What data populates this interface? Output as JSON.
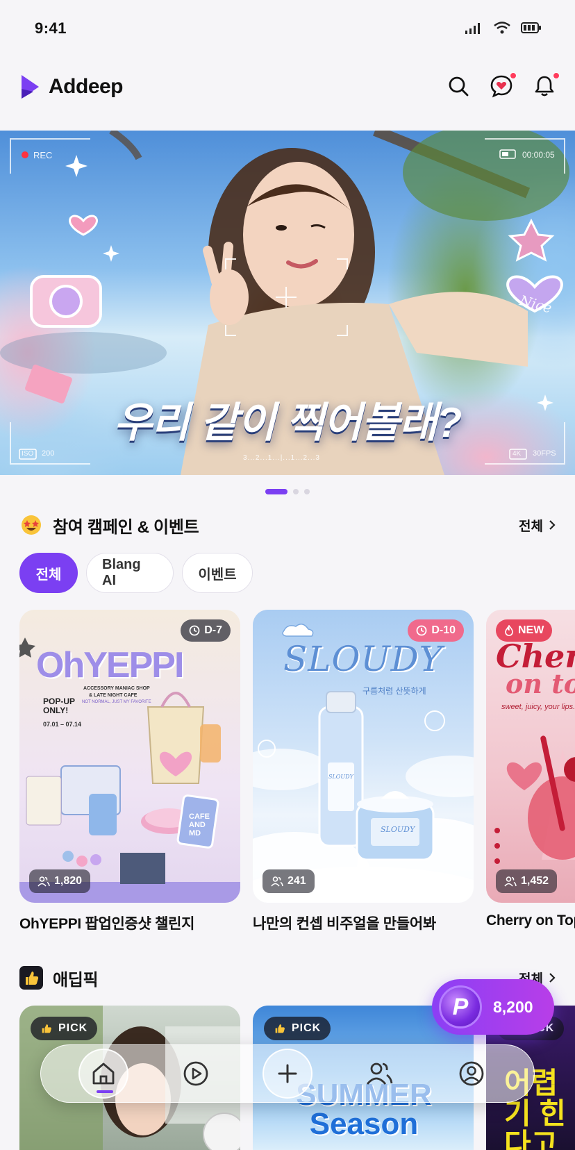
{
  "status_bar": {
    "time": "9:41"
  },
  "header": {
    "app_name": "Addeep",
    "icons": [
      "search-icon",
      "heart-chat-icon",
      "bell-icon"
    ]
  },
  "hero": {
    "rec_label": "REC",
    "timer": "00:00:05",
    "iso_label": "ISO",
    "iso_value": "200",
    "format_label": "4K",
    "fps": "30FPS",
    "exposure_scale": "3...2...1...|...1...2...3",
    "headline": "우리 같이 찍어볼래?",
    "sticker_text": "Nice",
    "slides_total": 3,
    "active_slide": 1
  },
  "campaign_section": {
    "title": "참여 캠페인 & 이벤트",
    "see_all": "전체",
    "filters": [
      {
        "label": "전체",
        "active": true
      },
      {
        "label": "Blang AI",
        "active": false
      },
      {
        "label": "이벤트",
        "active": false
      }
    ],
    "cards": [
      {
        "title": "OhYEPPI 팝업인증샷 챌린지",
        "badge": "D-7",
        "participants": "1,820",
        "poster": {
          "logo": "OhYEPPI",
          "line1": "ACCESSORY MANIAC SHOP",
          "line2": "& LATE NIGHT CAFE",
          "line3": "NOT NORMAL, JUST MY FAVORITE",
          "popup": "POP-UP ONLY!",
          "dates": "07.01 – 07.14",
          "cafe": "CAFE AND MD"
        }
      },
      {
        "title": "나만의 컨셉 비주얼을 만들어봐",
        "badge": "D-10",
        "participants": "241",
        "poster": {
          "logo": "SLOUDY",
          "tagline": "구름처럼 산뜻하게",
          "bottle_label": "SLOUDY",
          "jar_label": "SLOUDY"
        }
      },
      {
        "title": "Cherry on Top",
        "badge": "NEW",
        "participants": "1,452",
        "poster": {
          "line1": "Cherry",
          "line2": "on top",
          "tagline": "sweet, juicy, your lips."
        }
      }
    ]
  },
  "pick_section": {
    "title": "애딥픽",
    "see_all": "전체",
    "cards": [
      {
        "badge": "PICK",
        "text": ""
      },
      {
        "badge": "PICK",
        "text": "SUMMER Season"
      },
      {
        "badge": "PICK",
        "text": "어렵기 힌다고"
      }
    ]
  },
  "points": {
    "symbol": "P",
    "value": "8,200"
  },
  "bottom_nav": {
    "items": [
      {
        "icon": "home-icon",
        "active": true
      },
      {
        "icon": "play-icon",
        "active": false
      },
      {
        "icon": "plus-icon",
        "active": false
      },
      {
        "icon": "people-icon",
        "active": false
      },
      {
        "icon": "profile-icon",
        "active": false
      }
    ]
  },
  "colors": {
    "accent": "#7b3ff2",
    "badge_dark": "#3c3c46",
    "badge_pink": "#f06a8c",
    "badge_rose": "#e8475f",
    "notification": "#ff3b5c"
  }
}
